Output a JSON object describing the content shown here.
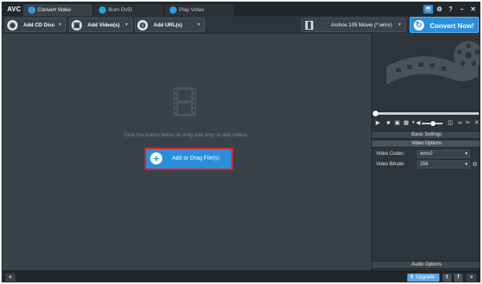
{
  "app": {
    "logo": "AVC"
  },
  "tabs": [
    {
      "label": "Convert Video",
      "active": true
    },
    {
      "label": "Burn DVD",
      "active": false
    },
    {
      "label": "Play Video",
      "active": false
    }
  ],
  "window_controls": {
    "settings": "⚙",
    "help": "?",
    "minimize": "–",
    "close": "✕"
  },
  "toolbar": {
    "add_cd": "Add CD Disc",
    "add_videos": "Add Video(s)",
    "add_url": "Add URL(s)",
    "output_format": "Archos 105 Movie (*.wmv)",
    "convert_now": "Convert Now!"
  },
  "main": {
    "hint": "Click the button below or drag and drop to add videos.",
    "add_button": "Add or Drag File(s)"
  },
  "panel": {
    "basic_settings": "Basic Settings",
    "video_options": "Video Options",
    "video_codec_label": "Video Codec:",
    "video_codec_value": "wmv2",
    "video_bitrate_label": "Video Bitrate:",
    "video_bitrate_value": "256",
    "audio_options": "Audio Options"
  },
  "bottom": {
    "upgrade": "Upgrade"
  },
  "colors": {
    "accent": "#2a8fdb",
    "highlight": "#e2202a",
    "background": "#3a4249"
  }
}
